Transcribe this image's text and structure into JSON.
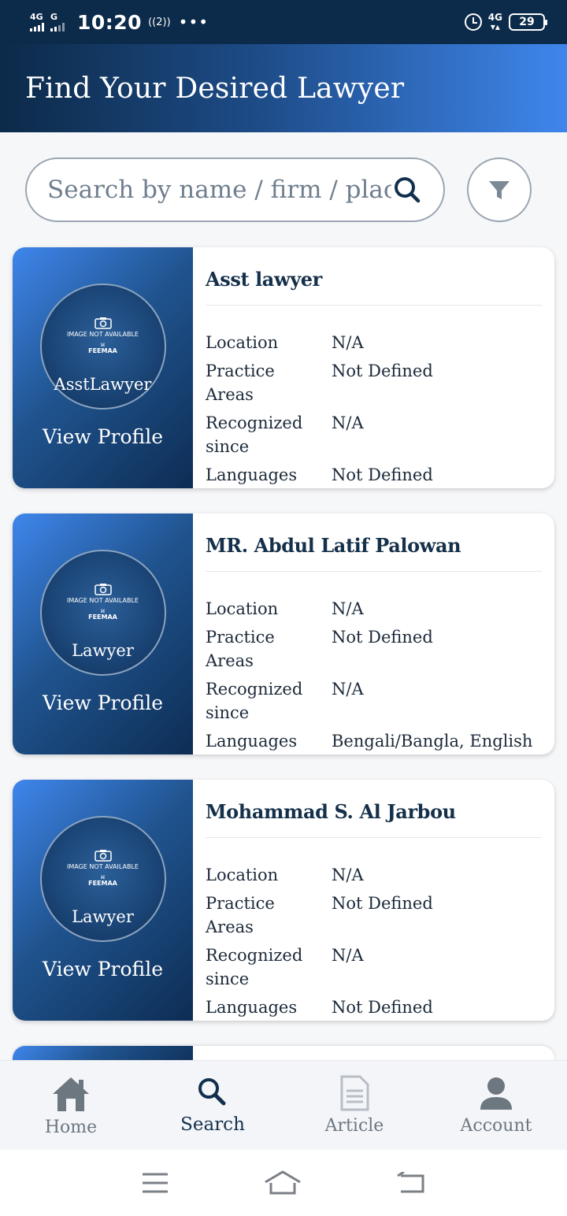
{
  "status_bar": {
    "net1": "4G",
    "net2": "G",
    "time": "10:20",
    "hotspot": "((2))",
    "dots": "•••",
    "net4g": "4G",
    "battery": "29"
  },
  "header": {
    "title": "Find Your Desired Lawyer"
  },
  "search": {
    "placeholder": "Search by name / firm / place"
  },
  "card_common": {
    "image_not_available": "IMAGE NOT AVAILABLE",
    "logo_text": "FEEMAA",
    "view_profile": "View Profile",
    "labels": {
      "location": "Location",
      "practice_areas": "Practice Areas",
      "recognized_since": "Recognized since",
      "languages": "Languages"
    }
  },
  "lawyers": [
    {
      "name": "Asst lawyer",
      "image_alt": "AsstLawyer",
      "location": "N/A",
      "practice_areas": "Not Defined",
      "recognized_since": "N/A",
      "languages": "Not Defined"
    },
    {
      "name": "MR. Abdul Latif Palowan",
      "image_alt": "Lawyer",
      "location": "N/A",
      "practice_areas": "Not Defined",
      "recognized_since": "N/A",
      "languages": "Bengali/Bangla, English"
    },
    {
      "name": "Mohammad S. Al Jarbou",
      "image_alt": "Lawyer",
      "location": "N/A",
      "practice_areas": "Not Defined",
      "recognized_since": "N/A",
      "languages": "Not Defined"
    }
  ],
  "bottom_nav": [
    {
      "label": "Home",
      "icon": "home-icon"
    },
    {
      "label": "Search",
      "icon": "search-icon",
      "active": true
    },
    {
      "label": "Article",
      "icon": "article-icon"
    },
    {
      "label": "Account",
      "icon": "account-icon"
    }
  ],
  "colors": {
    "primary_dark": "#0c2a49",
    "primary_light": "#3f86ec",
    "card_bg": "#ffffff"
  }
}
